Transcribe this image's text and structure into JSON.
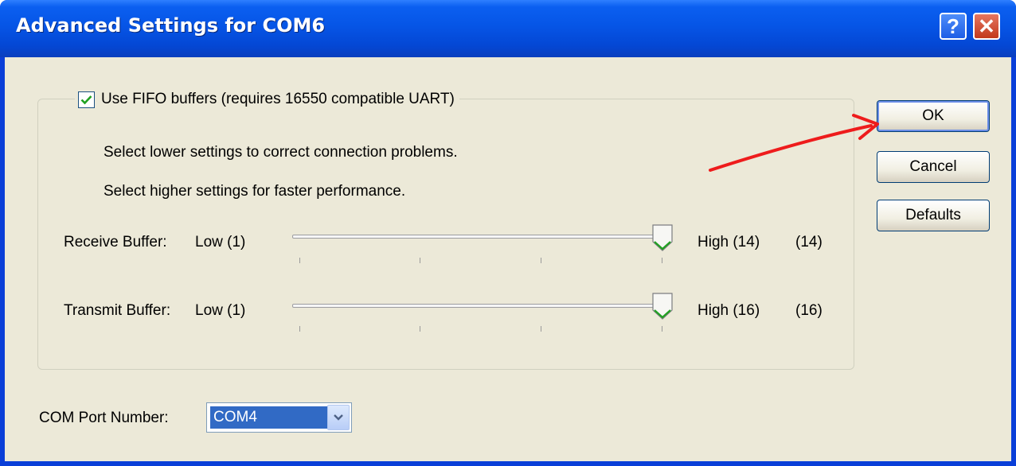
{
  "window": {
    "title": "Advanced Settings for COM6",
    "help_glyph": "?",
    "close_glyph": "✕"
  },
  "fifo": {
    "checkbox_label": "Use FIFO buffers (requires 16550 compatible UART)",
    "checked": true,
    "hint_lower": "Select lower settings to correct connection problems.",
    "hint_higher": "Select higher settings for faster performance."
  },
  "receive_buffer": {
    "label": "Receive Buffer:",
    "low_label": "Low (1)",
    "high_label": "High (14)",
    "value_label": "(14)",
    "level": 1.0
  },
  "transmit_buffer": {
    "label": "Transmit Buffer:",
    "low_label": "Low (1)",
    "high_label": "High (16)",
    "value_label": "(16)",
    "level": 1.0
  },
  "buttons": {
    "ok": "OK",
    "cancel": "Cancel",
    "defaults": "Defaults"
  },
  "com_port": {
    "label": "COM Port Number:",
    "selected": "COM4"
  },
  "colors": {
    "titlebar": "#0655e6",
    "dialog_bg": "#ece9d8",
    "annotation_arrow": "#ee1c1c",
    "selection": "#316ac5"
  }
}
